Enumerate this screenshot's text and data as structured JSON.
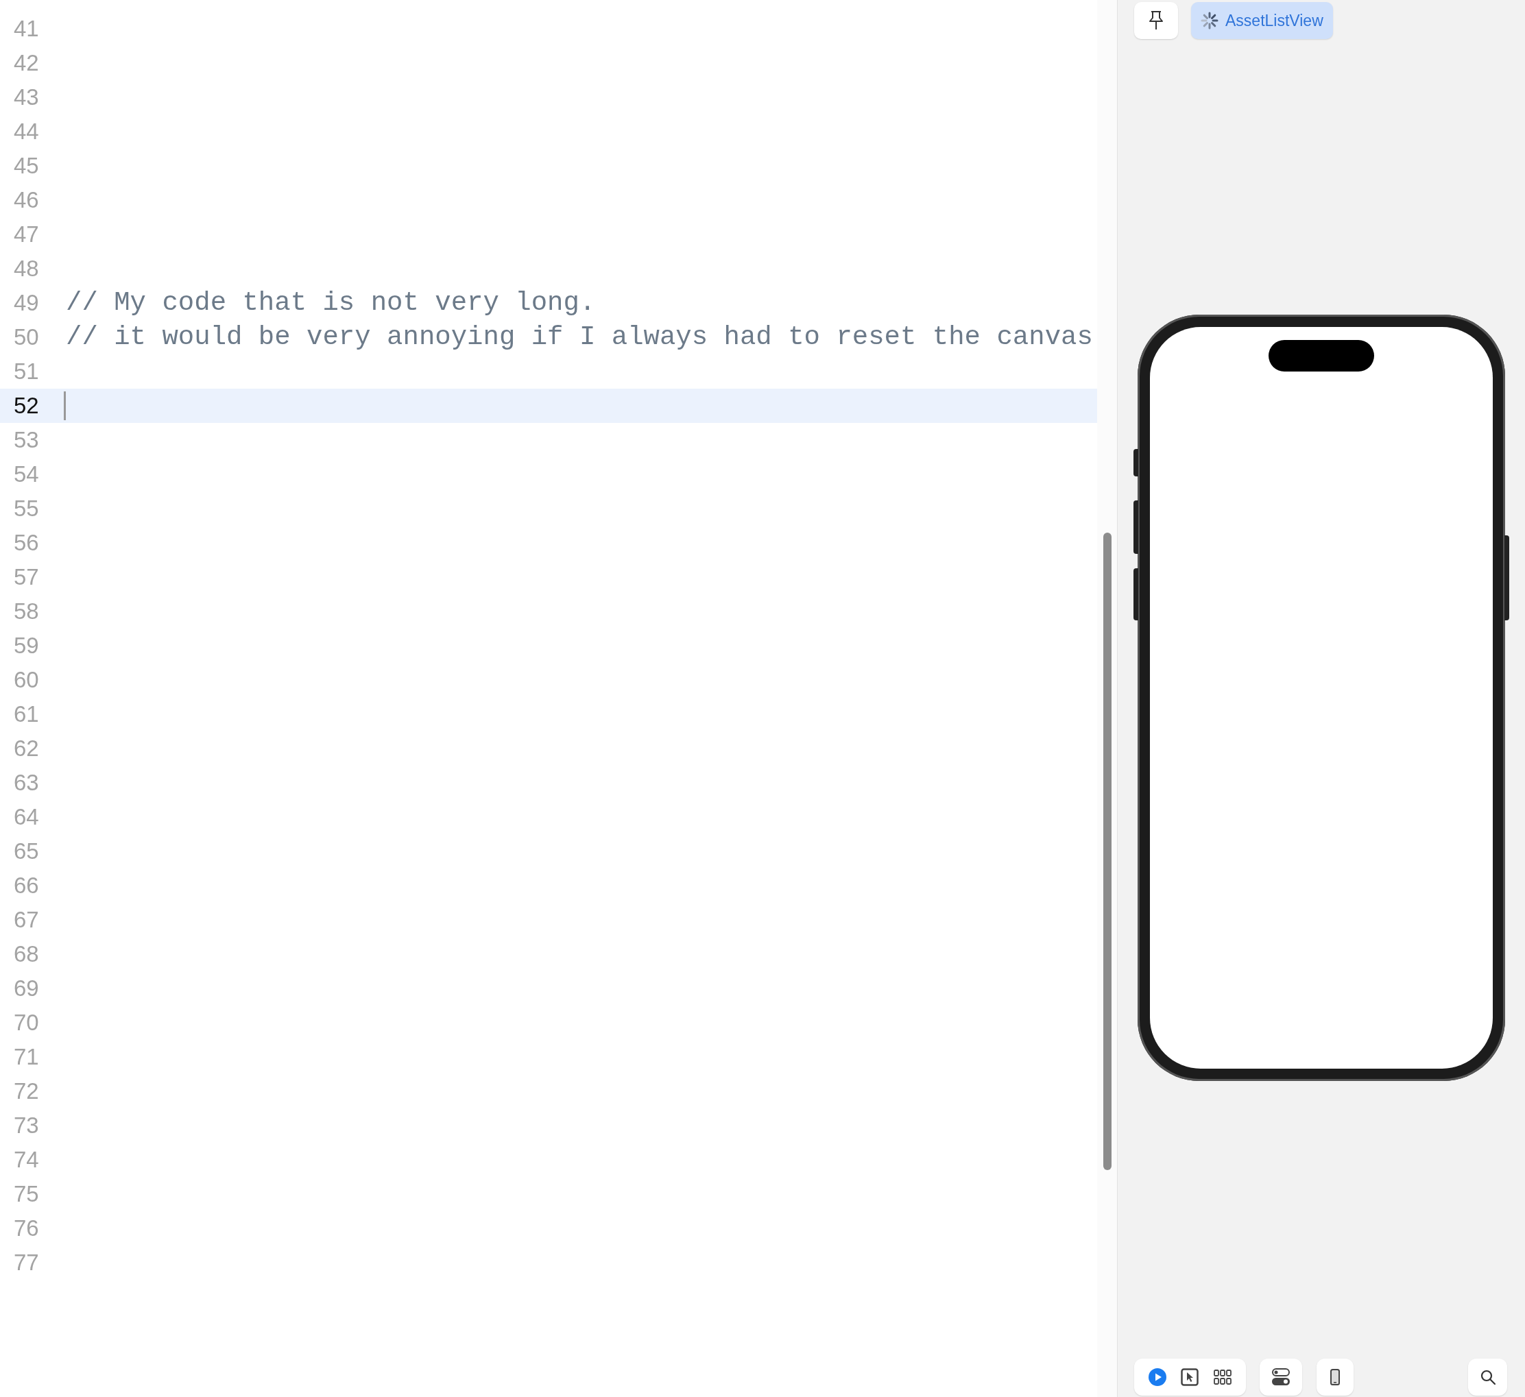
{
  "editor": {
    "lines": [
      {
        "number": "41",
        "current": false
      },
      {
        "number": "42",
        "current": false
      },
      {
        "number": "43",
        "current": false
      },
      {
        "number": "44",
        "current": false
      },
      {
        "number": "45",
        "current": false
      },
      {
        "number": "46",
        "current": false
      },
      {
        "number": "47",
        "current": false
      },
      {
        "number": "48",
        "current": false
      },
      {
        "number": "49",
        "text": "// My code that is not very long.",
        "current": false
      },
      {
        "number": "50",
        "text": "// it would be very annoying if I always had to reset the canvas",
        "current": false
      },
      {
        "number": "51",
        "current": false
      },
      {
        "number": "52",
        "current": true
      },
      {
        "number": "53",
        "current": false
      },
      {
        "number": "54",
        "current": false
      },
      {
        "number": "55",
        "current": false
      },
      {
        "number": "56",
        "current": false
      },
      {
        "number": "57",
        "current": false
      },
      {
        "number": "58",
        "current": false
      },
      {
        "number": "59",
        "current": false
      },
      {
        "number": "60",
        "current": false
      },
      {
        "number": "61",
        "current": false
      },
      {
        "number": "62",
        "current": false
      },
      {
        "number": "63",
        "current": false
      },
      {
        "number": "64",
        "current": false
      },
      {
        "number": "65",
        "current": false
      },
      {
        "number": "66",
        "current": false
      },
      {
        "number": "67",
        "current": false
      },
      {
        "number": "68",
        "current": false
      },
      {
        "number": "69",
        "current": false
      },
      {
        "number": "70",
        "current": false
      },
      {
        "number": "71",
        "current": false
      },
      {
        "number": "72",
        "current": false
      },
      {
        "number": "73",
        "current": false
      },
      {
        "number": "74",
        "current": false
      },
      {
        "number": "75",
        "current": false
      },
      {
        "number": "76",
        "current": false
      },
      {
        "number": "77",
        "current": false
      }
    ]
  },
  "preview": {
    "view_name": "AssetListView",
    "loading": true,
    "modes": [
      {
        "kind": "live",
        "selected": true
      },
      {
        "kind": "selectable",
        "selected": false
      },
      {
        "kind": "variants",
        "selected": false
      }
    ]
  }
}
